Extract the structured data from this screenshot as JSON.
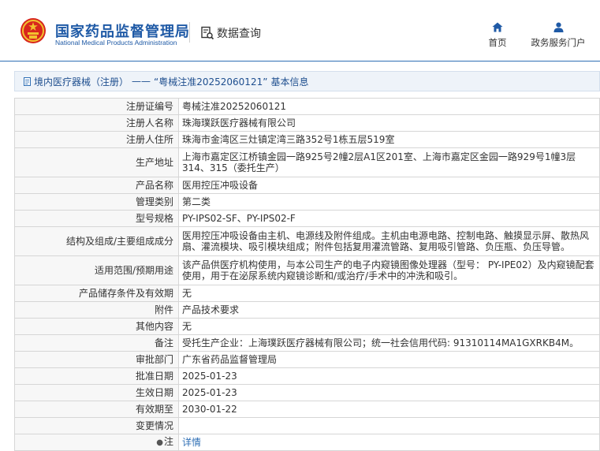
{
  "header": {
    "site_name_cn": "国家药品监督管理局",
    "site_name_en": "National Medical Products Administration",
    "query_label": "数据查询",
    "nav": {
      "home": "首页",
      "portal": "政务服务门户"
    }
  },
  "breadcrumb": {
    "category": "境内医疗器械（注册）",
    "separator": "——",
    "record": "“粤械注准20252060121”",
    "suffix": "基本信息"
  },
  "rows": [
    {
      "label": "注册证编号",
      "value": "粤械注准20252060121"
    },
    {
      "label": "注册人名称",
      "value": "珠海璞跃医疗器械有限公司"
    },
    {
      "label": "注册人住所",
      "value": "珠海市金湾区三灶镇定湾三路352号1栋五层519室"
    },
    {
      "label": "生产地址",
      "value": "上海市嘉定区江桥镇金园一路925号2幢2层A1区201室、上海市嘉定区金园一路929号1幢3层314、315（委托生产）"
    },
    {
      "label": "产品名称",
      "value": "医用控压冲吸设备"
    },
    {
      "label": "管理类别",
      "value": "第二类"
    },
    {
      "label": "型号规格",
      "value": "PY-IPS02-SF、PY-IPS02-F"
    },
    {
      "label": "结构及组成/主要组成成分",
      "value": "医用控压冲吸设备由主机、电源线及附件组成。主机由电源电路、控制电路、触摸显示屏、散热风扇、灌流模块、吸引模块组成；附件包括复用灌流管路、复用吸引管路、负压瓶、负压导管。"
    },
    {
      "label": "适用范围/预期用途",
      "value": "该产品供医疗机构使用，与本公司生产的电子内窥镜图像处理器（型号： PY-IPE02）及内窥镜配套使用，用于在泌尿系统内窥镜诊断和/或治疗/手术中的冲洗和吸引。"
    },
    {
      "label": "产品储存条件及有效期",
      "value": "无"
    },
    {
      "label": "附件",
      "value": "产品技术要求"
    },
    {
      "label": "其他内容",
      "value": "无"
    },
    {
      "label": "备注",
      "value": "受托生产企业：上海璞跃医疗器械有限公司；统一社会信用代码: 91310114MA1GXRKB4M。"
    },
    {
      "label": "审批部门",
      "value": "广东省药品监督管理局"
    },
    {
      "label": "批准日期",
      "value": "2025-01-23"
    },
    {
      "label": "生效日期",
      "value": "2025-01-23"
    },
    {
      "label": "有效期至",
      "value": "2030-01-22"
    },
    {
      "label": "变更情况",
      "value": ""
    },
    {
      "label": "注",
      "value": "详情"
    }
  ],
  "colors": {
    "brand_blue": "#1f5aa6",
    "link_blue": "#2f6fb5",
    "emblem_red": "#d8261d",
    "emblem_gold": "#f2c12e"
  },
  "icons": {
    "emblem": "national-emblem-icon",
    "query": "search-document-icon",
    "home": "home-icon",
    "portal": "user-icon",
    "breadcrumb": "document-icon",
    "note": "pin-icon"
  }
}
